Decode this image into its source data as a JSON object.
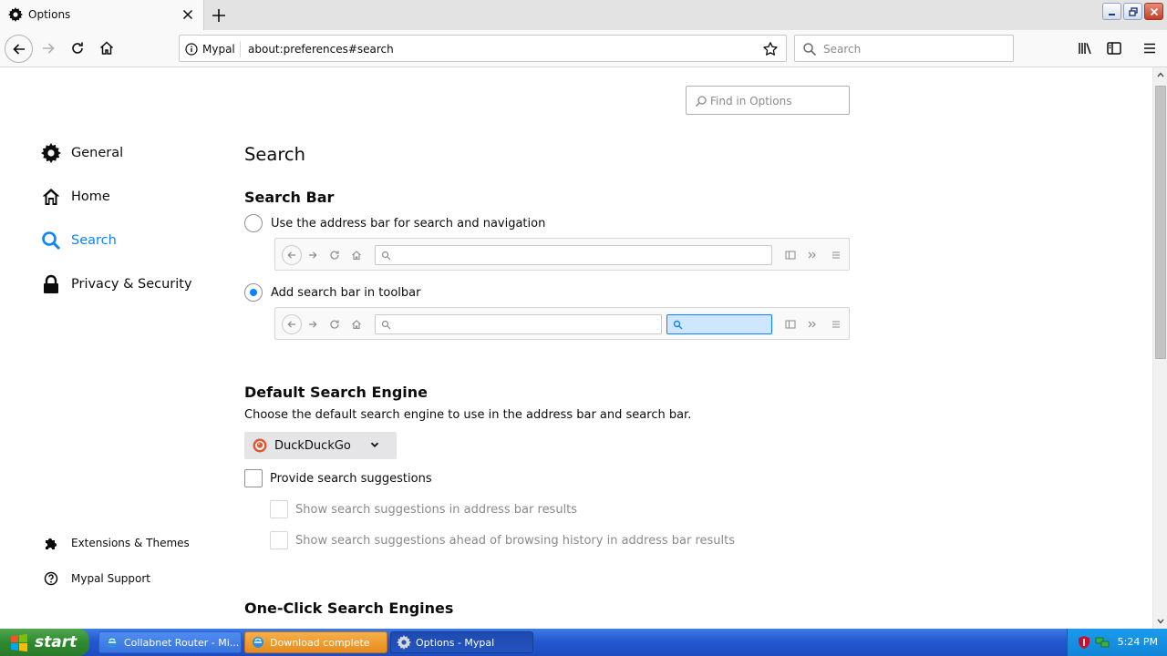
{
  "tab": {
    "title": "Options"
  },
  "urlbar": {
    "identity": "Mypal",
    "url": "about:preferences#search"
  },
  "searchbar": {
    "placeholder": "Search"
  },
  "find": {
    "placeholder": "Find in Options"
  },
  "sidebar": {
    "items": [
      {
        "label": "General",
        "icon": "gear-icon"
      },
      {
        "label": "Home",
        "icon": "home-icon"
      },
      {
        "label": "Search",
        "icon": "search-icon",
        "selected": true
      },
      {
        "label": "Privacy & Security",
        "icon": "lock-icon"
      }
    ],
    "footer": [
      {
        "label": "Extensions & Themes",
        "icon": "puzzle-icon"
      },
      {
        "label": "Mypal Support",
        "icon": "help-icon"
      }
    ]
  },
  "main": {
    "title": "Search",
    "search_bar": {
      "heading": "Search Bar",
      "option_address": "Use the address bar for search and navigation",
      "option_toolbar": "Add search bar in toolbar",
      "selected": "toolbar"
    },
    "default_engine": {
      "heading": "Default Search Engine",
      "description": "Choose the default search engine to use in the address bar and search bar.",
      "selected_engine": "DuckDuckGo",
      "provide_suggestions": "Provide search suggestions",
      "show_in_address": "Show search suggestions in address bar results",
      "show_ahead": "Show search suggestions ahead of browsing history in address bar results"
    },
    "one_click": {
      "heading": "One-Click Search Engines"
    }
  },
  "taskbar": {
    "start": "start",
    "tasks": [
      {
        "label": "Collabnet Router - Mi...",
        "state": "normal"
      },
      {
        "label": "Download complete",
        "state": "alert"
      },
      {
        "label": "Options - Mypal",
        "state": "active"
      }
    ],
    "clock": "5:24 PM"
  },
  "colors": {
    "accent": "#0a84ff",
    "taskbar": "#2458d0",
    "start": "#2f8a2f"
  }
}
